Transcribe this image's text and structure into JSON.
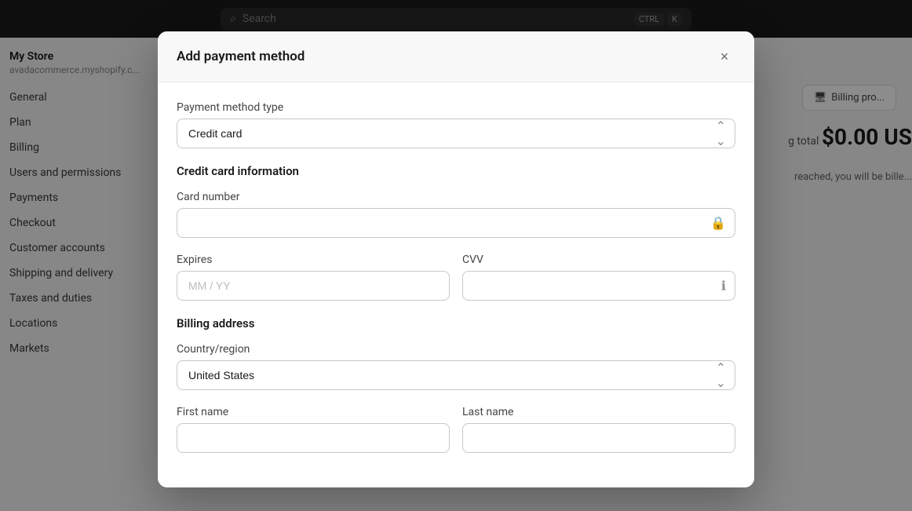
{
  "topbar": {
    "search_placeholder": "Search",
    "shortcut_ctrl": "CTRL",
    "shortcut_key": "K"
  },
  "sidebar": {
    "store_name": "My Store",
    "store_url": "avadacommerce.myshopify.c...",
    "items": [
      {
        "label": "General"
      },
      {
        "label": "Plan"
      },
      {
        "label": "Billing"
      },
      {
        "label": "Users and permissions"
      },
      {
        "label": "Payments"
      },
      {
        "label": "Checkout"
      },
      {
        "label": "Customer accounts"
      },
      {
        "label": "Shipping and delivery"
      },
      {
        "label": "Taxes and duties"
      },
      {
        "label": "Locations"
      },
      {
        "label": "Markets"
      }
    ]
  },
  "content": {
    "billing_pro_label": "Billing pro...",
    "total_label": "g total",
    "total_amount": "$0.00 US",
    "billing_note": "reached, you will be bille..."
  },
  "modal": {
    "title": "Add payment method",
    "close_label": "×",
    "payment_method_type_label": "Payment method type",
    "payment_method_options": [
      {
        "value": "credit_card",
        "label": "Credit card"
      }
    ],
    "payment_method_selected": "Credit card",
    "credit_card_section_title": "Credit card information",
    "card_number_label": "Card number",
    "card_number_placeholder": "",
    "expires_label": "Expires",
    "expires_placeholder": "MM / YY",
    "cvv_label": "CVV",
    "cvv_placeholder": "",
    "billing_address_section_title": "Billing address",
    "country_region_label": "Country/region",
    "country_options": [
      {
        "value": "us",
        "label": "United States"
      }
    ],
    "country_selected": "United States",
    "first_name_label": "First name",
    "first_name_placeholder": "",
    "last_name_label": "Last name",
    "last_name_placeholder": ""
  }
}
